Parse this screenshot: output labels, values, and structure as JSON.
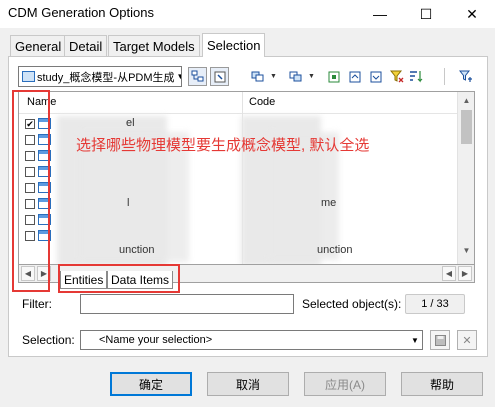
{
  "window": {
    "title": "CDM Generation Options",
    "minimize": "—",
    "maximize": "☐",
    "close": "✕"
  },
  "tabs": [
    {
      "label": "General"
    },
    {
      "label": "Detail"
    },
    {
      "label": "Target Models"
    },
    {
      "label": "Selection"
    }
  ],
  "toolbar": {
    "model_select_value": "study_概念模型-从PDM生成"
  },
  "grid": {
    "columns": [
      "Name",
      "Code"
    ],
    "rows": [
      {
        "checked": true,
        "name": "",
        "code": ""
      },
      {
        "checked": false,
        "name": "",
        "code": ""
      },
      {
        "checked": false,
        "name": "",
        "code": ""
      },
      {
        "checked": false,
        "name": "",
        "code": ""
      },
      {
        "checked": false,
        "name": "",
        "code": ""
      },
      {
        "checked": false,
        "name": "",
        "code": ""
      },
      {
        "checked": false,
        "name": "",
        "code": ""
      },
      {
        "checked": false,
        "name": "",
        "code": ""
      }
    ],
    "partial_texts": {
      "row1_name_tail": "el",
      "row6_name_tail": "l",
      "row8_name_tail": "unction",
      "row6_code_tail": "me",
      "row8_code_tail": "unction"
    }
  },
  "subtabs": [
    {
      "label": "Entities"
    },
    {
      "label": "Data Items"
    }
  ],
  "filter": {
    "label": "Filter:",
    "value": ""
  },
  "selected_objects": {
    "label": "Selected object(s):",
    "value": "1 / 33"
  },
  "selection": {
    "label": "Selection:",
    "placeholder": "<Name your selection>"
  },
  "buttons": {
    "ok": "确定",
    "cancel": "取消",
    "apply": "应用(A)",
    "help": "帮助"
  },
  "annotation": {
    "text": "选择哪些物理模型要生成概念模型, 默认全选",
    "color": "#e53935"
  }
}
